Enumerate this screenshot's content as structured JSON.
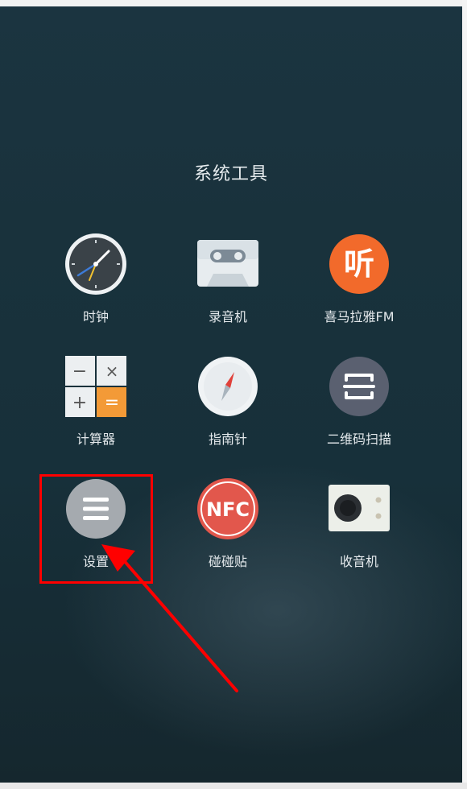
{
  "folder": {
    "title": "系统工具"
  },
  "apps": {
    "clock": {
      "label": "时钟"
    },
    "recorder": {
      "label": "录音机"
    },
    "ximalaya": {
      "label": "喜马拉雅FM",
      "icon_text": "听"
    },
    "calculator": {
      "label": "计算器",
      "keys": [
        "−",
        "×",
        "+",
        "="
      ]
    },
    "compass": {
      "label": "指南针"
    },
    "qr_scanner": {
      "label": "二维码扫描"
    },
    "settings": {
      "label": "设置"
    },
    "nfc": {
      "label": "碰碰贴",
      "icon_text": "NFC"
    },
    "radio": {
      "label": "收音机"
    }
  },
  "annotation": {
    "color": "#ff0000"
  },
  "colors": {
    "ximalaya": "#f26a2b",
    "nfc": "#e2574c",
    "settings": "#a5aaaf",
    "qr": "#5a6070"
  }
}
